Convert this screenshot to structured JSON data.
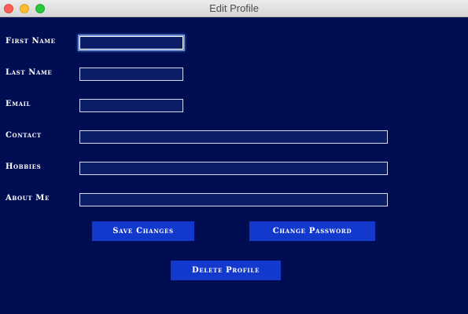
{
  "window": {
    "title": "Edit Profile"
  },
  "form": {
    "first_name": {
      "label": "First Name",
      "value": ""
    },
    "last_name": {
      "label": "Last Name",
      "value": ""
    },
    "email": {
      "label": "Email",
      "value": ""
    },
    "contact": {
      "label": "Contact",
      "value": ""
    },
    "hobbies": {
      "label": "Hobbies",
      "value": ""
    },
    "about_me": {
      "label": "About Me",
      "value": ""
    }
  },
  "buttons": {
    "save": "Save Changes",
    "change_password": "Change Password",
    "delete": "Delete Profile"
  },
  "colors": {
    "background": "#000d52",
    "field_fill": "#0d1e68",
    "button": "#1238cc",
    "text": "#ffffff"
  }
}
